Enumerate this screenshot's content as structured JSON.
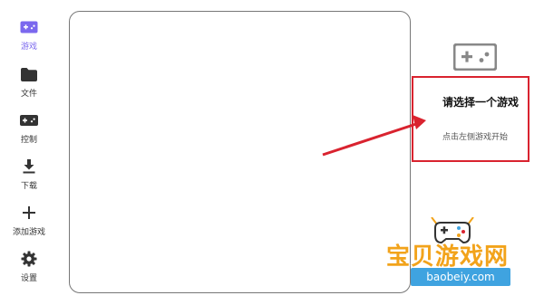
{
  "sidebar": {
    "items": [
      {
        "label": "游戏",
        "icon": "gamepad-icon",
        "active": true
      },
      {
        "label": "文件",
        "icon": "folder-icon",
        "active": false
      },
      {
        "label": "控制",
        "icon": "controller-icon",
        "active": false
      },
      {
        "label": "下载",
        "icon": "download-icon",
        "active": false
      },
      {
        "label": "添加游戏",
        "icon": "plus-icon",
        "active": false
      },
      {
        "label": "设置",
        "icon": "gear-icon",
        "active": false
      }
    ]
  },
  "hint": {
    "icon": "gamepad-icon",
    "title": "请选择一个游戏",
    "subtitle": "点击左侧游戏开始"
  },
  "watermark": {
    "brand": "宝贝游戏网",
    "url": "baobeiy.com"
  },
  "colors": {
    "accent": "#7b68ee",
    "icon": "#333333",
    "annotation_red": "#d9232f",
    "watermark_orange": "#f2a31b",
    "watermark_blue": "#3fa3e0"
  }
}
